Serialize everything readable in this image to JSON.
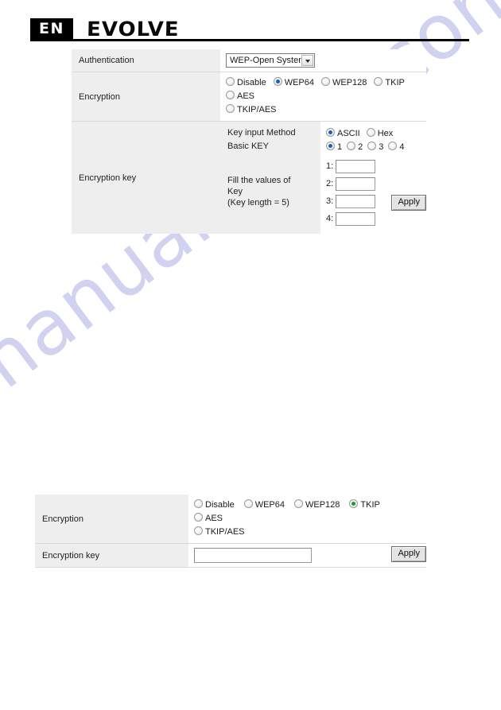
{
  "page": {
    "language_badge": "EN",
    "brand": "EVOLVE",
    "watermark": "manualshive.com",
    "accent_selected_blue": "#1760b8",
    "accent_selected_green": "#1e9a32",
    "label_cell_bg": "#eeeeee",
    "rule_color": "#d9d9d9"
  },
  "top_form": {
    "rows": {
      "authentication": {
        "label": "Authentication",
        "select": {
          "name": "authentication-select",
          "value": "WEP-Open System",
          "options": [
            "WEP-Open System"
          ]
        }
      },
      "encryption": {
        "label": "Encryption",
        "options": [
          {
            "label": "Disable",
            "selected": false
          },
          {
            "label": "WEP64",
            "selected": true
          },
          {
            "label": "WEP128",
            "selected": false
          },
          {
            "label": "TKIP",
            "selected": false
          },
          {
            "label": "AES",
            "selected": false
          },
          {
            "label": "TKIP/AES",
            "selected": false
          }
        ]
      },
      "encryption_key": {
        "label": "Encryption key",
        "key_input_method": {
          "label": "Key input Method",
          "options": [
            {
              "label": "ASCII",
              "selected": true
            },
            {
              "label": "Hex",
              "selected": false
            }
          ]
        },
        "basic_key": {
          "label": "Basic KEY",
          "options": [
            {
              "label": "1",
              "selected": true
            },
            {
              "label": "2",
              "selected": false
            },
            {
              "label": "3",
              "selected": false
            },
            {
              "label": "4",
              "selected": false
            }
          ]
        },
        "fill_values": {
          "line1": "Fill the values of",
          "line2": "Key",
          "line3": "(Key length = 5)",
          "fields": [
            {
              "num": "1:",
              "value": "",
              "placeholder": ""
            },
            {
              "num": "2:",
              "value": "",
              "placeholder": ""
            },
            {
              "num": "3:",
              "value": "",
              "placeholder": ""
            },
            {
              "num": "4:",
              "value": "",
              "placeholder": ""
            }
          ]
        }
      }
    },
    "apply_label": "Apply"
  },
  "bottom_form": {
    "rows": {
      "encryption": {
        "label": "Encryption",
        "options": [
          {
            "label": "Disable",
            "selected": false
          },
          {
            "label": "WEP64",
            "selected": false
          },
          {
            "label": "WEP128",
            "selected": false
          },
          {
            "label": "TKIP",
            "selected": true
          },
          {
            "label": "AES",
            "selected": false
          },
          {
            "label": "TKIP/AES",
            "selected": false
          }
        ]
      },
      "encryption_key": {
        "label": "Encryption key",
        "field": {
          "value": "",
          "placeholder": ""
        }
      }
    },
    "apply_label": "Apply"
  }
}
